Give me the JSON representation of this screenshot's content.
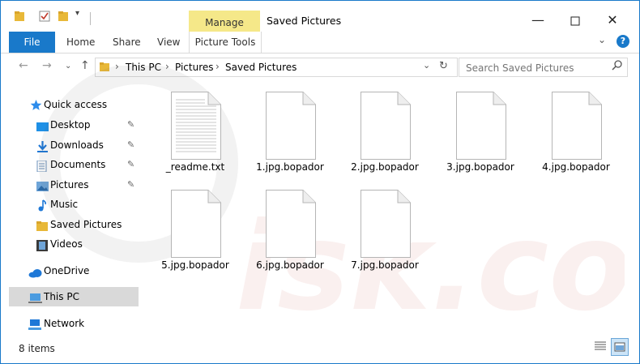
{
  "window": {
    "title": "Saved Pictures",
    "context_tab": "Manage"
  },
  "ribbon": {
    "tabs": [
      "File",
      "Home",
      "Share",
      "View",
      "Picture Tools"
    ]
  },
  "address": {
    "crumbs": [
      "This PC",
      "Pictures",
      "Saved Pictures"
    ],
    "search_placeholder": "Search Saved Pictures"
  },
  "sidebar": {
    "quick_access": "Quick access",
    "items": [
      "Desktop",
      "Downloads",
      "Documents",
      "Pictures",
      "Music",
      "Saved Pictures",
      "Videos"
    ],
    "onedrive": "OneDrive",
    "this_pc": "This PC",
    "network": "Network"
  },
  "files": [
    "_readme.txt",
    "1.jpg.bopador",
    "2.jpg.bopador",
    "3.jpg.bopador",
    "4.jpg.bopador",
    "5.jpg.bopador",
    "6.jpg.bopador",
    "7.jpg.bopador"
  ],
  "status": {
    "item_count": "8 items"
  },
  "colors": {
    "accent": "#1979ca",
    "manage_tab": "#f5e889",
    "folder": "#e8b838",
    "selection": "#d9d9d9"
  }
}
